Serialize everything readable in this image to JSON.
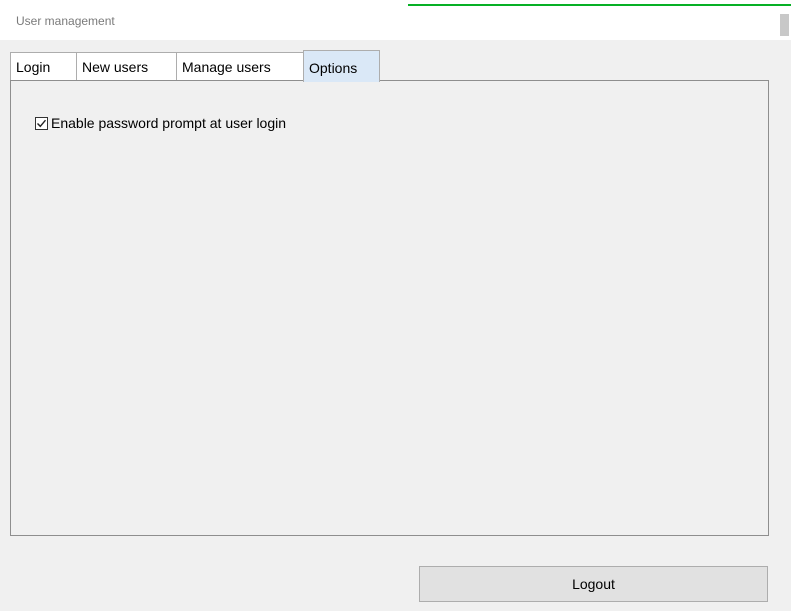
{
  "window": {
    "title": "User management"
  },
  "tabs": [
    {
      "label": "Login",
      "selected": false
    },
    {
      "label": "New users",
      "selected": false
    },
    {
      "label": "Manage users",
      "selected": false
    },
    {
      "label": "Options",
      "selected": true
    }
  ],
  "options": {
    "password_prompt": {
      "label": "Enable password prompt at user login",
      "checked": true
    }
  },
  "footer": {
    "logout_label": "Logout"
  },
  "colors": {
    "selected_tab": "#dae8f7",
    "progress": "#06b025",
    "background": "#f0f0f0"
  }
}
